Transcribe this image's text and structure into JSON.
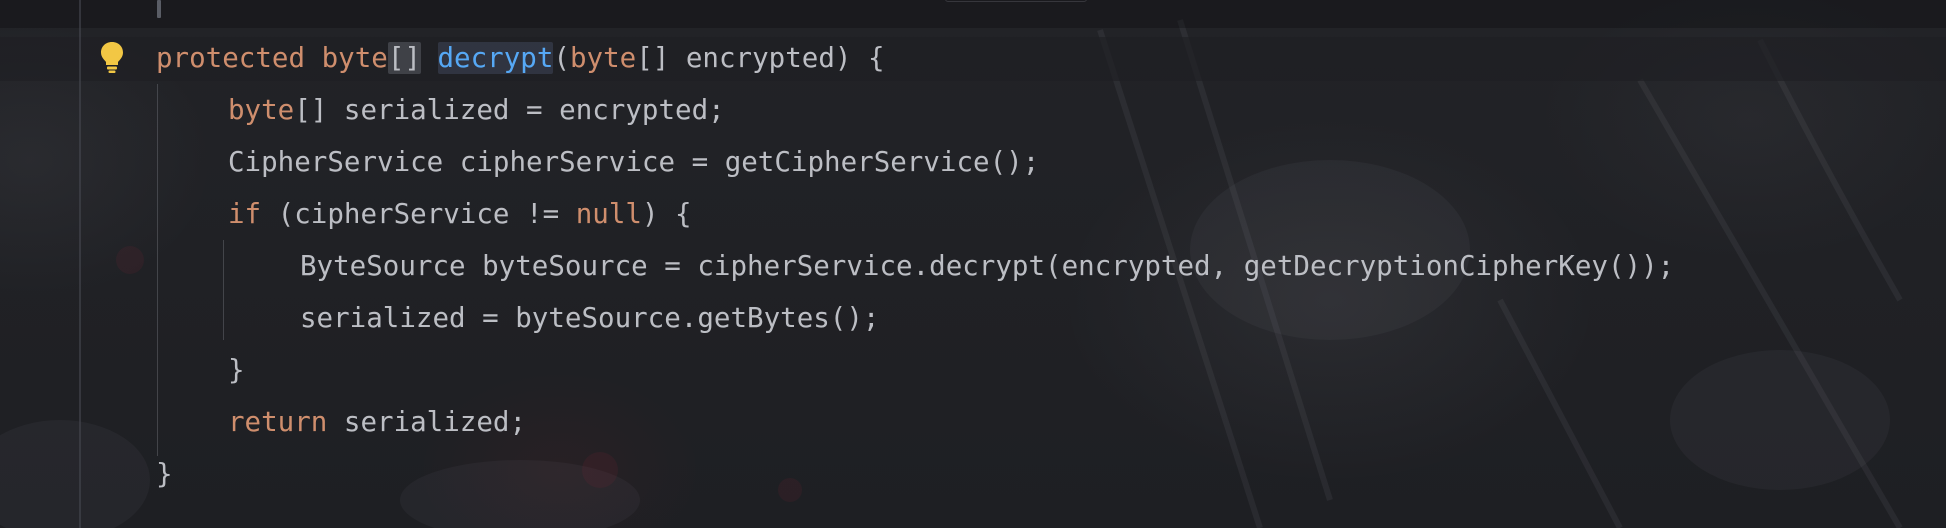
{
  "editor": {
    "lines": [
      [
        {
          "t": "protected",
          "c": "kw"
        },
        {
          "t": " "
        },
        {
          "t": "byte",
          "c": "kw"
        },
        {
          "t": "[]",
          "c": "hl"
        },
        {
          "t": " "
        },
        {
          "t": "decrypt",
          "c": "fn hl-fn"
        },
        {
          "t": "("
        },
        {
          "t": "byte",
          "c": "kw"
        },
        {
          "t": "[] encrypted) {"
        }
      ],
      [
        {
          "t": "byte",
          "c": "kw"
        },
        {
          "t": "[] serialized = encrypted;"
        }
      ],
      [
        {
          "t": "CipherService cipherService = getCipherService();"
        }
      ],
      [
        {
          "t": "if",
          "c": "kw"
        },
        {
          "t": " (cipherService != "
        },
        {
          "t": "null",
          "c": "kw"
        },
        {
          "t": ") {"
        }
      ],
      [
        {
          "t": "ByteSource byteSource = cipherService.decrypt(encrypted, getDecryptionCipherKey());"
        }
      ],
      [
        {
          "t": "serialized = byteSource.getBytes();"
        }
      ],
      [
        {
          "t": "}"
        }
      ],
      [
        {
          "t": "return",
          "c": "kw"
        },
        {
          "t": " serialized;"
        }
      ],
      [
        {
          "t": "}"
        }
      ]
    ],
    "colors": {
      "keyword": "#cf8e6d",
      "method": "#56a8f5",
      "text": "#bcbec4",
      "bulb": "#f2c744"
    },
    "gutter_icon": "lightbulb-icon"
  }
}
